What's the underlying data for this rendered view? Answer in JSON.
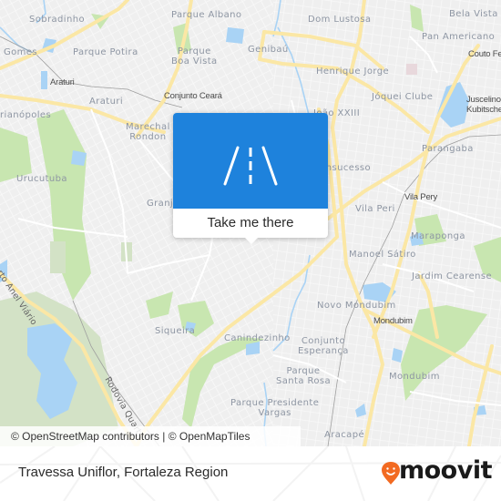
{
  "map": {
    "colors": {
      "land": "#efefef",
      "street": "#ffffff",
      "major_road": "#fbe7a5",
      "water": "#a9d3f5",
      "park": "#c8e6b0",
      "forest": "#d3e2c6"
    },
    "neighborhood_labels": [
      {
        "id": "sobradinho",
        "text": "Sobradinho"
      },
      {
        "id": "parque-albano",
        "text": "Parque Albano"
      },
      {
        "id": "dom-lustosa",
        "text": "Dom Lustosa"
      },
      {
        "id": "bela-vista",
        "text": "Bela Vista"
      },
      {
        "id": "gomes",
        "text": "Gomes"
      },
      {
        "id": "parque-potira",
        "text": "Parque Potira"
      },
      {
        "id": "parque-boa-vista",
        "text": "Parque\nBoa Vista"
      },
      {
        "id": "genibau",
        "text": "Genibaú"
      },
      {
        "id": "pan-americano",
        "text": "Pan Americano"
      },
      {
        "id": "henrique-jorge",
        "text": "Henrique Jorge"
      },
      {
        "id": "araturi",
        "text": "Araturi"
      },
      {
        "id": "joquei-clube",
        "text": "Jóquei Clube"
      },
      {
        "id": "arianopoles",
        "text": "rianópoles"
      },
      {
        "id": "marechal-rondon",
        "text": "Marechal\nRondon"
      },
      {
        "id": "joao-xxiii",
        "text": "João XXIII"
      },
      {
        "id": "parangaba",
        "text": "Parangaba"
      },
      {
        "id": "urucutuba",
        "text": "Urucutuba"
      },
      {
        "id": "bom-sucesso",
        "text": "Bonsucesso"
      },
      {
        "id": "granja",
        "text": "Granja"
      },
      {
        "id": "vila-peri",
        "text": "Vila Peri"
      },
      {
        "id": "maraponga",
        "text": "Maraponga"
      },
      {
        "id": "manoel-satiro",
        "text": "Manoel Sátiro"
      },
      {
        "id": "jardim-cearense",
        "text": "Jardim Cearense"
      },
      {
        "id": "novo-mondubim",
        "text": "Novo Mondubim"
      },
      {
        "id": "siqueira",
        "text": "Siqueira"
      },
      {
        "id": "canindezinho",
        "text": "Canindezinho"
      },
      {
        "id": "conjunto-esperanca",
        "text": "Conjunto\nEsperança"
      },
      {
        "id": "mondubim",
        "text": "Mondubim"
      },
      {
        "id": "parque-santa-rosa",
        "text": "Parque\nSanta Rosa"
      },
      {
        "id": "parque-presidente-vargas",
        "text": "Parque Presidente\nVargas"
      },
      {
        "id": "aracape",
        "text": "Aracapé"
      }
    ],
    "place_labels": [
      {
        "id": "araturi-station",
        "text": "Araturi"
      },
      {
        "id": "conjunto-ceara",
        "text": "Conjunto Ceará"
      },
      {
        "id": "couto-fernandes",
        "text": "Couto Fe"
      },
      {
        "id": "juscelino-kubitschek",
        "text": "Juscelino\nKubitsche"
      },
      {
        "id": "vila-pery",
        "text": "Vila Pery"
      },
      {
        "id": "mondubim-station",
        "text": "Mondubim"
      }
    ],
    "road_labels": [
      {
        "id": "quarto-anel-viario",
        "text": "Quarto Anel Viário"
      },
      {
        "id": "rodovia-quarto",
        "text": "Rodovia Quarto"
      }
    ]
  },
  "popup": {
    "icon": "road-icon",
    "cta_label": "Take me there"
  },
  "attribution": "© OpenStreetMap contributors | © OpenMapTiles",
  "footer": {
    "place_name": "Travessa Uniflor, Fortaleza Region",
    "brand": "moovit",
    "brand_icon": "moovit-pin-smiley-icon",
    "brand_color": "#f26a21"
  }
}
